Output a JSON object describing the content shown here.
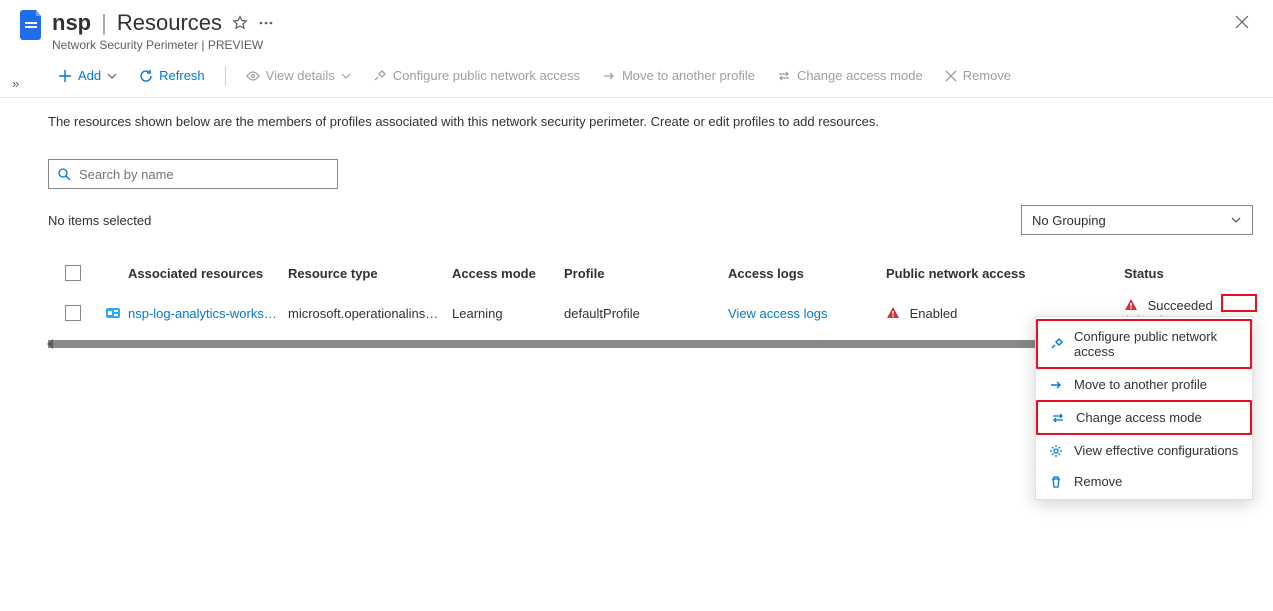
{
  "header": {
    "resource_name": "nsp",
    "separator": "|",
    "section": "Resources",
    "subtitle": "Network Security Perimeter | PREVIEW"
  },
  "toolbar": {
    "collapse_glyph": "»",
    "add_label": "Add",
    "refresh_label": "Refresh",
    "view_details_label": "View details",
    "configure_pna_label": "Configure public network access",
    "move_profile_label": "Move to another profile",
    "change_access_label": "Change access mode",
    "remove_label": "Remove"
  },
  "description": "The resources shown below are the members of profiles associated with this network security perimeter. Create or edit profiles to add resources.",
  "search": {
    "placeholder": "Search by name"
  },
  "filter": {
    "selection_text": "No items selected",
    "grouping_value": "No Grouping"
  },
  "columns": {
    "name": "Associated resources",
    "type": "Resource type",
    "mode": "Access mode",
    "profile": "Profile",
    "logs": "Access logs",
    "pna": "Public network access",
    "status": "Status"
  },
  "rows": [
    {
      "name": "nsp-log-analytics-works…",
      "type": "microsoft.operationalins…",
      "mode": "Learning",
      "profile": "defaultProfile",
      "logs": "View access logs",
      "pna": "Enabled",
      "status": "Succeeded",
      "status_link": "(View issu…"
    }
  ],
  "context_menu": {
    "configure": "Configure public network access",
    "move": "Move to another profile",
    "change": "Change access mode",
    "view_effective": "View effective configurations",
    "remove": "Remove"
  },
  "colors": {
    "link": "#0078d4",
    "warn": "#d13438",
    "highlight": "#e81123"
  }
}
